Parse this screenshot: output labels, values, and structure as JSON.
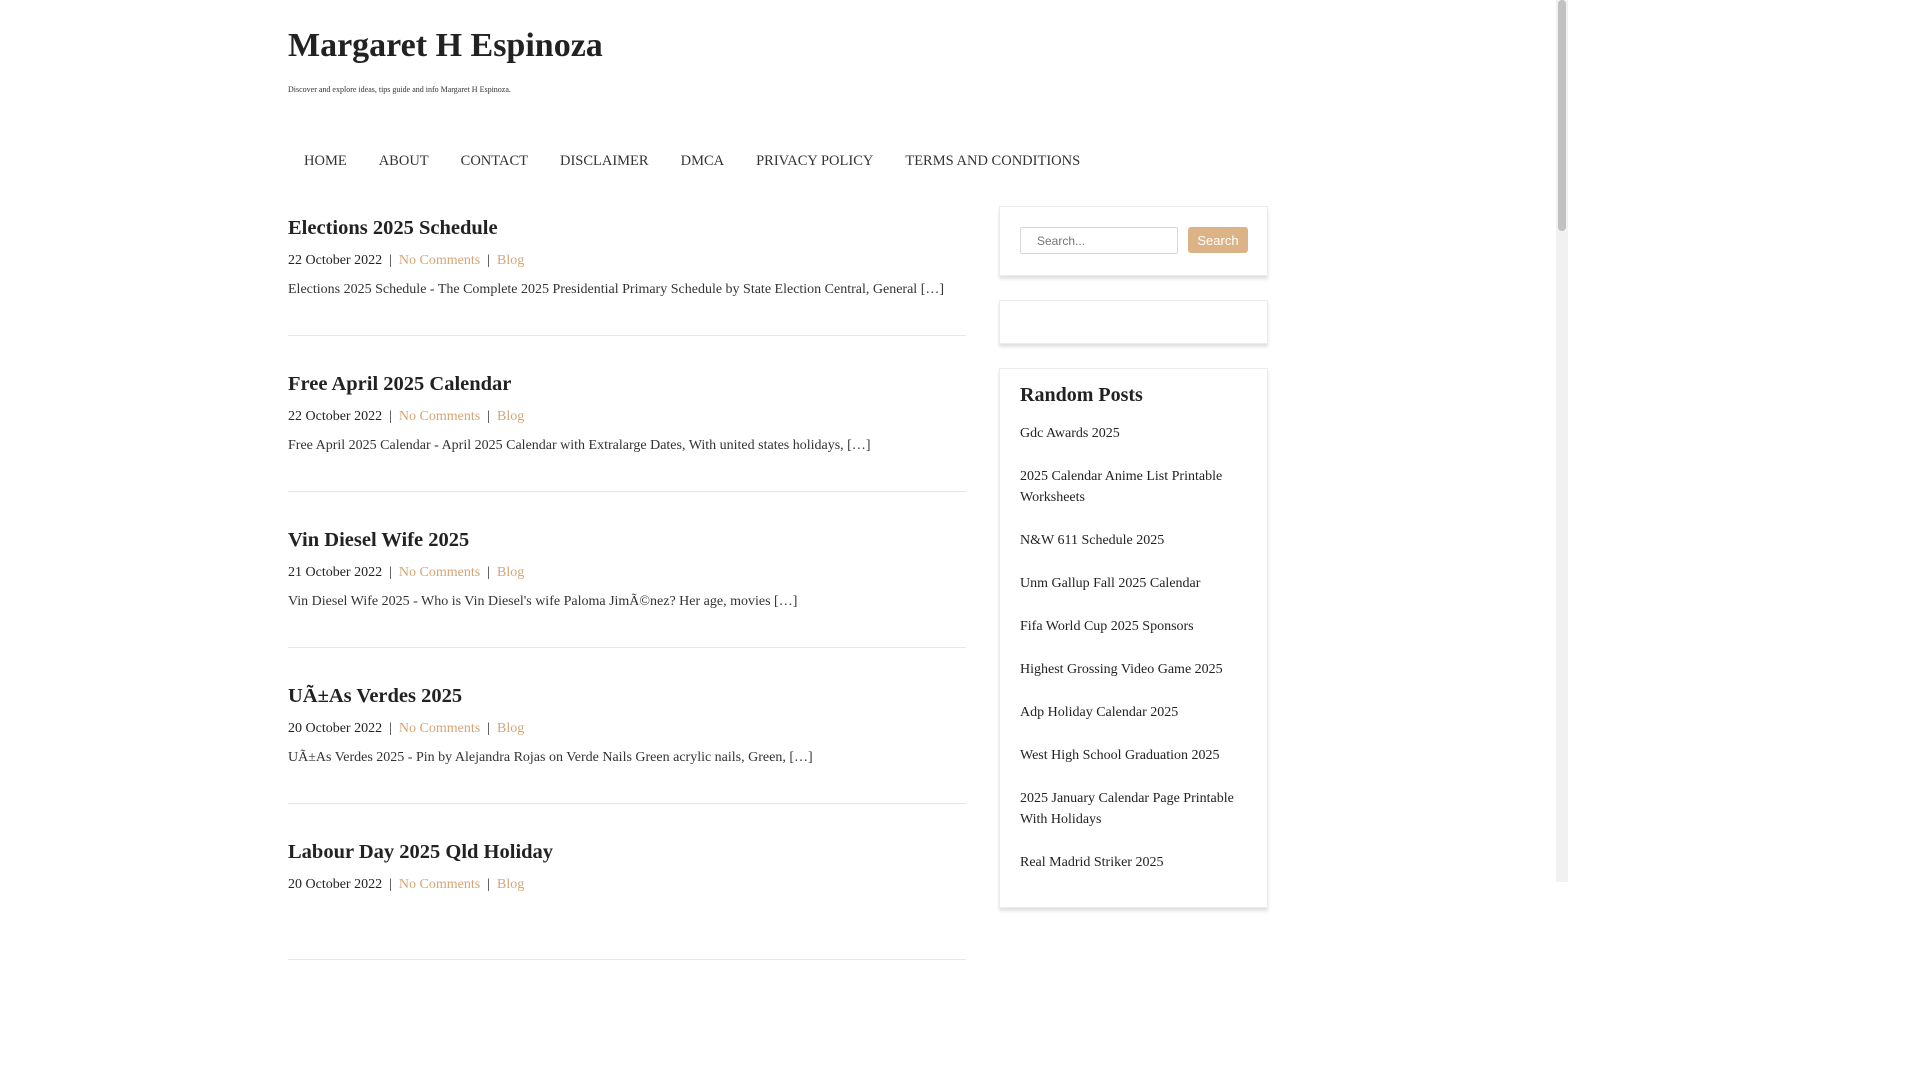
{
  "site": {
    "title": "Margaret H Espinoza",
    "description": "Discover and explore ideas, tips guide and info Margaret H Espinoza."
  },
  "nav": {
    "items": [
      "HOME",
      "ABOUT",
      "CONTACT",
      "DISCLAIMER",
      "DMCA",
      "PRIVACY POLICY",
      "TERMS AND CONDITIONS"
    ]
  },
  "posts": [
    {
      "title": "Elections 2025 Schedule",
      "date": "22 October 2022",
      "comments": "No Comments",
      "category": "Blog",
      "excerpt": "Elections 2025 Schedule - The Complete 2025 Presidential Primary Schedule by State Election Central, General […]"
    },
    {
      "title": "Free April 2025 Calendar",
      "date": "22 October 2022",
      "comments": "No Comments",
      "category": "Blog",
      "excerpt": "Free April 2025 Calendar - April 2025 Calendar with Extralarge Dates, With united states holidays, […]"
    },
    {
      "title": "Vin Diesel Wife 2025",
      "date": "21 October 2022",
      "comments": "No Comments",
      "category": "Blog",
      "excerpt": "Vin Diesel Wife 2025 - Who is Vin Diesel's wife Paloma JimÃ©nez? Her age, movies […]"
    },
    {
      "title": "UÃ±As Verdes 2025",
      "date": "20 October 2022",
      "comments": "No Comments",
      "category": "Blog",
      "excerpt": "UÃ±As Verdes 2025 - Pin by Alejandra Rojas on Verde Nails Green acrylic nails, Green, […]"
    },
    {
      "title": "Labour Day 2025 Qld Holiday",
      "date": "20 October 2022",
      "comments": "No Comments",
      "category": "Blog",
      "excerpt": ""
    }
  ],
  "meta_separator": "|",
  "search": {
    "placeholder": "Search...",
    "button": "Search"
  },
  "random_posts": {
    "title": "Random Posts",
    "items": [
      "Gdc Awards 2025",
      "2025 Calendar Anime List Printable Worksheets",
      "N&W 611 Schedule 2025",
      "Unm Gallup Fall 2025 Calendar",
      "Fifa World Cup 2025 Sponsors",
      "Highest Grossing Video Game 2025",
      "Adp Holiday Calendar 2025",
      "West High School Graduation 2025",
      "2025 January Calendar Page Printable With Holidays",
      "Real Madrid Striker 2025"
    ]
  },
  "colors": {
    "accent": "#d4a574",
    "button": "#dcb387"
  }
}
